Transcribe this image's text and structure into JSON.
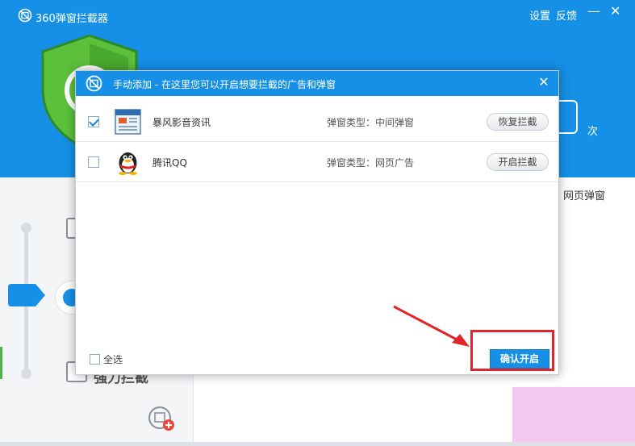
{
  "app": {
    "title": "360弹窗拦截器",
    "header_links": {
      "settings": "设置",
      "feedback": "反馈"
    },
    "window_controls": {
      "minimize": "—",
      "close": "✕"
    },
    "count_unit": "次",
    "right_mode_label": "网页弹窗",
    "bottom_mode_label": "强力拦截",
    "accent_color": "#1590e6"
  },
  "dialog": {
    "title": "手动添加 - 在这里您可以开启想要拦截的广告和弹窗",
    "close_label": "✕",
    "rows": [
      {
        "checked": true,
        "icon": "storm-video-news-icon",
        "name": "暴风影音资讯",
        "type_text": "弹窗类型：中间弹窗",
        "button_label": "恢复拦截"
      },
      {
        "checked": false,
        "icon": "qq-penguin-icon",
        "name": "腾讯QQ",
        "type_text": "弹窗类型：网页广告",
        "button_label": "开启拦截"
      }
    ],
    "select_all_label": "全选",
    "confirm_label": "确认开启"
  },
  "annotation": {
    "highlight_color": "#e0262b"
  }
}
